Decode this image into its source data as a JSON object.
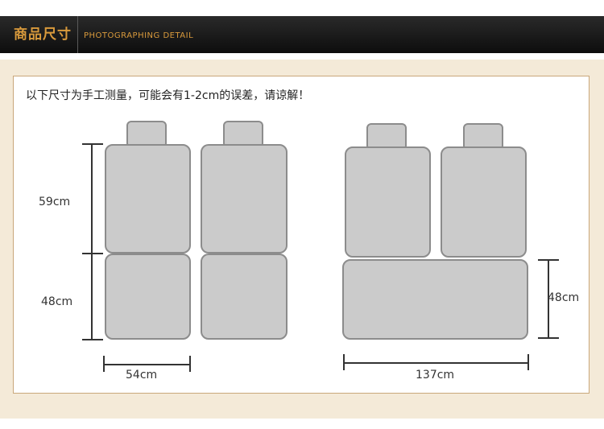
{
  "header": {
    "title": "商品尺寸",
    "subtitle": "PHOTOGRAPHING DETAIL"
  },
  "note": "以下尺寸为手工测量，可能会有1-2cm的误差，请谅解！",
  "dimensions": {
    "front_back_height": "59cm",
    "front_seat_height": "48cm",
    "front_width": "54cm",
    "rear_bench_height": "48cm",
    "rear_width": "137cm"
  }
}
